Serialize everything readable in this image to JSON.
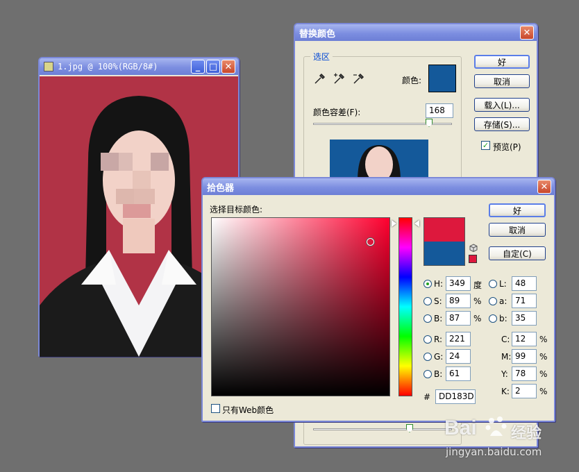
{
  "image_window": {
    "title": "1.jpg @ 100%(RGB/8#)",
    "buttons": [
      "_",
      "□",
      "✕"
    ],
    "photo_bg": "#b13346"
  },
  "replace_dialog": {
    "title": "替换颜色",
    "group_label": "选区",
    "color_label": "颜色:",
    "color_swatch": "#14599a",
    "tolerance_label": "颜色容差(F):",
    "tolerance_value": "168",
    "ok": "好",
    "cancel": "取消",
    "load": "载入(L)...",
    "save": "存储(S)...",
    "preview_label": "预览(P)",
    "preview_checked": true,
    "preview_bg": "#14599a"
  },
  "picker_dialog": {
    "title": "拾色器",
    "target_label": "选择目标颜色:",
    "ok": "好",
    "cancel": "取消",
    "custom": "自定(C)",
    "new_color": "#dd183d",
    "old_color": "#14599a",
    "hue_deg": 349,
    "hsb": {
      "h_label": "H:",
      "h": "349",
      "h_unit": "度",
      "s_label": "S:",
      "s": "89",
      "s_unit": "%",
      "b_label": "B:",
      "b": "87",
      "b_unit": "%"
    },
    "lab": {
      "l_label": "L:",
      "l": "48",
      "a_label": "a:",
      "a": "71",
      "b_label": "b:",
      "b": "35"
    },
    "rgb": {
      "r_label": "R:",
      "r": "221",
      "g_label": "G:",
      "g": "24",
      "b_label": "B:",
      "b": "61"
    },
    "cmyk": {
      "c_label": "C:",
      "c": "12",
      "m_label": "M:",
      "m": "99",
      "y_label": "Y:",
      "y": "78",
      "k_label": "K:",
      "k": "2",
      "unit": "%"
    },
    "hash": "#",
    "hex": "DD183D",
    "web_only_label": "只有Web颜色"
  },
  "watermark": {
    "brand": "Bai",
    "brand2": "经验",
    "url": "jingyan.baidu.com"
  }
}
